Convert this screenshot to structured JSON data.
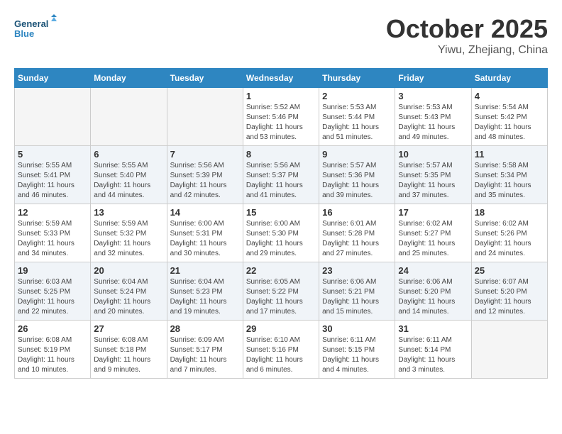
{
  "header": {
    "logo_line1": "General",
    "logo_line2": "Blue",
    "month": "October 2025",
    "location": "Yiwu, Zhejiang, China"
  },
  "days_of_week": [
    "Sunday",
    "Monday",
    "Tuesday",
    "Wednesday",
    "Thursday",
    "Friday",
    "Saturday"
  ],
  "weeks": [
    [
      {
        "day": "",
        "info": ""
      },
      {
        "day": "",
        "info": ""
      },
      {
        "day": "",
        "info": ""
      },
      {
        "day": "1",
        "info": "Sunrise: 5:52 AM\nSunset: 5:46 PM\nDaylight: 11 hours\nand 53 minutes."
      },
      {
        "day": "2",
        "info": "Sunrise: 5:53 AM\nSunset: 5:44 PM\nDaylight: 11 hours\nand 51 minutes."
      },
      {
        "day": "3",
        "info": "Sunrise: 5:53 AM\nSunset: 5:43 PM\nDaylight: 11 hours\nand 49 minutes."
      },
      {
        "day": "4",
        "info": "Sunrise: 5:54 AM\nSunset: 5:42 PM\nDaylight: 11 hours\nand 48 minutes."
      }
    ],
    [
      {
        "day": "5",
        "info": "Sunrise: 5:55 AM\nSunset: 5:41 PM\nDaylight: 11 hours\nand 46 minutes."
      },
      {
        "day": "6",
        "info": "Sunrise: 5:55 AM\nSunset: 5:40 PM\nDaylight: 11 hours\nand 44 minutes."
      },
      {
        "day": "7",
        "info": "Sunrise: 5:56 AM\nSunset: 5:39 PM\nDaylight: 11 hours\nand 42 minutes."
      },
      {
        "day": "8",
        "info": "Sunrise: 5:56 AM\nSunset: 5:37 PM\nDaylight: 11 hours\nand 41 minutes."
      },
      {
        "day": "9",
        "info": "Sunrise: 5:57 AM\nSunset: 5:36 PM\nDaylight: 11 hours\nand 39 minutes."
      },
      {
        "day": "10",
        "info": "Sunrise: 5:57 AM\nSunset: 5:35 PM\nDaylight: 11 hours\nand 37 minutes."
      },
      {
        "day": "11",
        "info": "Sunrise: 5:58 AM\nSunset: 5:34 PM\nDaylight: 11 hours\nand 35 minutes."
      }
    ],
    [
      {
        "day": "12",
        "info": "Sunrise: 5:59 AM\nSunset: 5:33 PM\nDaylight: 11 hours\nand 34 minutes."
      },
      {
        "day": "13",
        "info": "Sunrise: 5:59 AM\nSunset: 5:32 PM\nDaylight: 11 hours\nand 32 minutes."
      },
      {
        "day": "14",
        "info": "Sunrise: 6:00 AM\nSunset: 5:31 PM\nDaylight: 11 hours\nand 30 minutes."
      },
      {
        "day": "15",
        "info": "Sunrise: 6:00 AM\nSunset: 5:30 PM\nDaylight: 11 hours\nand 29 minutes."
      },
      {
        "day": "16",
        "info": "Sunrise: 6:01 AM\nSunset: 5:28 PM\nDaylight: 11 hours\nand 27 minutes."
      },
      {
        "day": "17",
        "info": "Sunrise: 6:02 AM\nSunset: 5:27 PM\nDaylight: 11 hours\nand 25 minutes."
      },
      {
        "day": "18",
        "info": "Sunrise: 6:02 AM\nSunset: 5:26 PM\nDaylight: 11 hours\nand 24 minutes."
      }
    ],
    [
      {
        "day": "19",
        "info": "Sunrise: 6:03 AM\nSunset: 5:25 PM\nDaylight: 11 hours\nand 22 minutes."
      },
      {
        "day": "20",
        "info": "Sunrise: 6:04 AM\nSunset: 5:24 PM\nDaylight: 11 hours\nand 20 minutes."
      },
      {
        "day": "21",
        "info": "Sunrise: 6:04 AM\nSunset: 5:23 PM\nDaylight: 11 hours\nand 19 minutes."
      },
      {
        "day": "22",
        "info": "Sunrise: 6:05 AM\nSunset: 5:22 PM\nDaylight: 11 hours\nand 17 minutes."
      },
      {
        "day": "23",
        "info": "Sunrise: 6:06 AM\nSunset: 5:21 PM\nDaylight: 11 hours\nand 15 minutes."
      },
      {
        "day": "24",
        "info": "Sunrise: 6:06 AM\nSunset: 5:20 PM\nDaylight: 11 hours\nand 14 minutes."
      },
      {
        "day": "25",
        "info": "Sunrise: 6:07 AM\nSunset: 5:20 PM\nDaylight: 11 hours\nand 12 minutes."
      }
    ],
    [
      {
        "day": "26",
        "info": "Sunrise: 6:08 AM\nSunset: 5:19 PM\nDaylight: 11 hours\nand 10 minutes."
      },
      {
        "day": "27",
        "info": "Sunrise: 6:08 AM\nSunset: 5:18 PM\nDaylight: 11 hours\nand 9 minutes."
      },
      {
        "day": "28",
        "info": "Sunrise: 6:09 AM\nSunset: 5:17 PM\nDaylight: 11 hours\nand 7 minutes."
      },
      {
        "day": "29",
        "info": "Sunrise: 6:10 AM\nSunset: 5:16 PM\nDaylight: 11 hours\nand 6 minutes."
      },
      {
        "day": "30",
        "info": "Sunrise: 6:11 AM\nSunset: 5:15 PM\nDaylight: 11 hours\nand 4 minutes."
      },
      {
        "day": "31",
        "info": "Sunrise: 6:11 AM\nSunset: 5:14 PM\nDaylight: 11 hours\nand 3 minutes."
      },
      {
        "day": "",
        "info": ""
      }
    ]
  ]
}
